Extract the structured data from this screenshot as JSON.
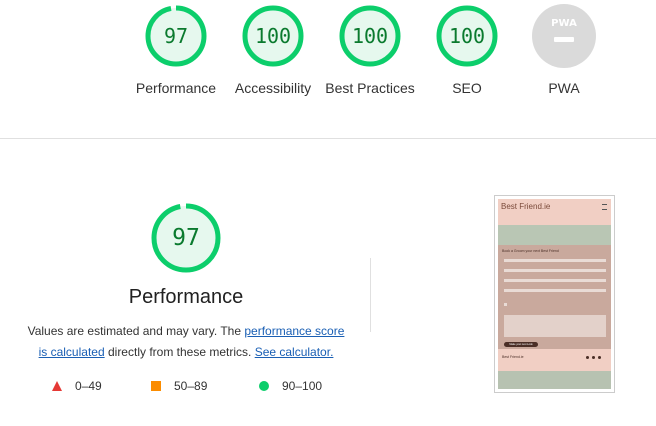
{
  "scores": [
    {
      "label": "Performance",
      "value": "97",
      "fraction": 0.97
    },
    {
      "label": "Accessibility",
      "value": "100",
      "fraction": 1.0
    },
    {
      "label": "Best Practices",
      "value": "100",
      "fraction": 1.0
    },
    {
      "label": "SEO",
      "value": "100",
      "fraction": 1.0
    },
    {
      "label": "PWA",
      "value": "PWA"
    }
  ],
  "performance": {
    "score": "97",
    "fraction": 0.97,
    "title": "Performance",
    "desc_prefix": "Values are estimated and may vary. The ",
    "link_score": "performance score is calculated",
    "desc_middle": " directly from these metrics. ",
    "link_calculator": "See calculator."
  },
  "legend": [
    {
      "range": "0–49",
      "color": "#e53935"
    },
    {
      "range": "50–89",
      "color": "#fb8c00"
    },
    {
      "range": "90–100",
      "color": "#0cce6b"
    }
  ],
  "screenshot": {
    "brand": "Best Friend.ie",
    "form_title": "Book a Groom your next Best Friend",
    "submit_label": "Make your next Look",
    "footer_brand": "Best Friend.ie"
  },
  "colors": {
    "pass": "#0cce6b",
    "pass_fill": "#e6f8ee",
    "pass_text": "#0a7a2e",
    "pwa_gray": "#d9d9d9"
  }
}
